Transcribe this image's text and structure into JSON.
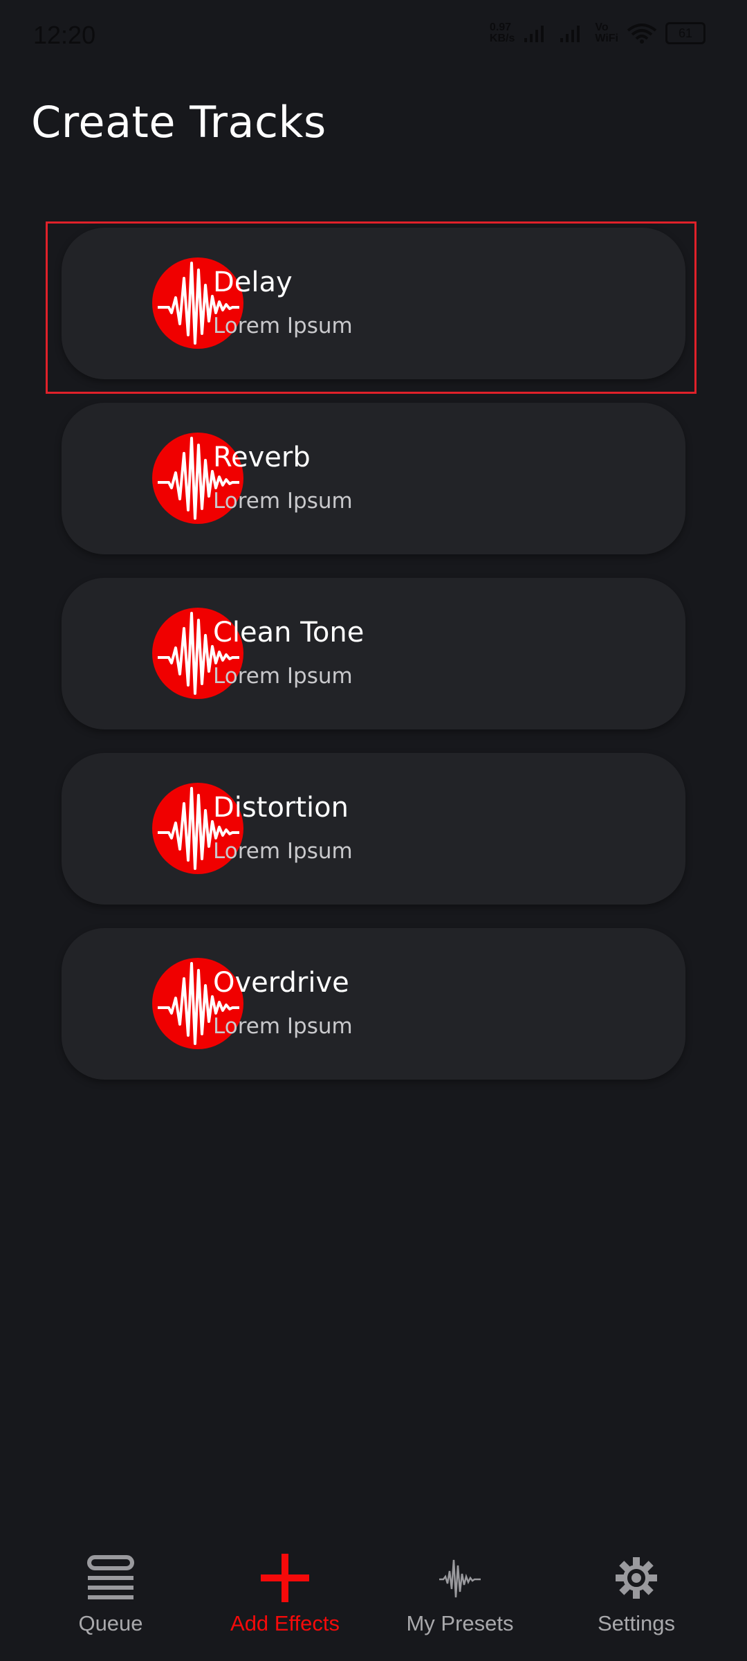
{
  "status_bar": {
    "time": "12:20",
    "net_speed": "0.97",
    "net_unit": "KB/s",
    "vowifi_top": "Vo",
    "vowifi_bottom": "WiFi",
    "battery": "61"
  },
  "header": {
    "title": "Create Tracks"
  },
  "effects": [
    {
      "name": "Delay",
      "subtitle": "Lorem Ipsum",
      "icon": "waveform-icon"
    },
    {
      "name": "Reverb",
      "subtitle": "Lorem Ipsum",
      "icon": "waveform-icon"
    },
    {
      "name": "Clean Tone",
      "subtitle": "Lorem Ipsum",
      "icon": "waveform-icon"
    },
    {
      "name": "Distortion",
      "subtitle": "Lorem Ipsum",
      "icon": "waveform-icon"
    },
    {
      "name": "Overdrive",
      "subtitle": "Lorem Ipsum",
      "icon": "waveform-icon"
    }
  ],
  "nav": [
    {
      "label": "Queue",
      "icon": "queue-icon"
    },
    {
      "label": "Add Effects",
      "icon": "plus-icon",
      "active": true
    },
    {
      "label": "My Presets",
      "icon": "waveform-icon"
    },
    {
      "label": "Settings",
      "icon": "gear-icon"
    }
  ],
  "colors": {
    "accent": "#f00000",
    "background": "#17181c",
    "card": "#222327",
    "highlight": "#e0212a"
  }
}
